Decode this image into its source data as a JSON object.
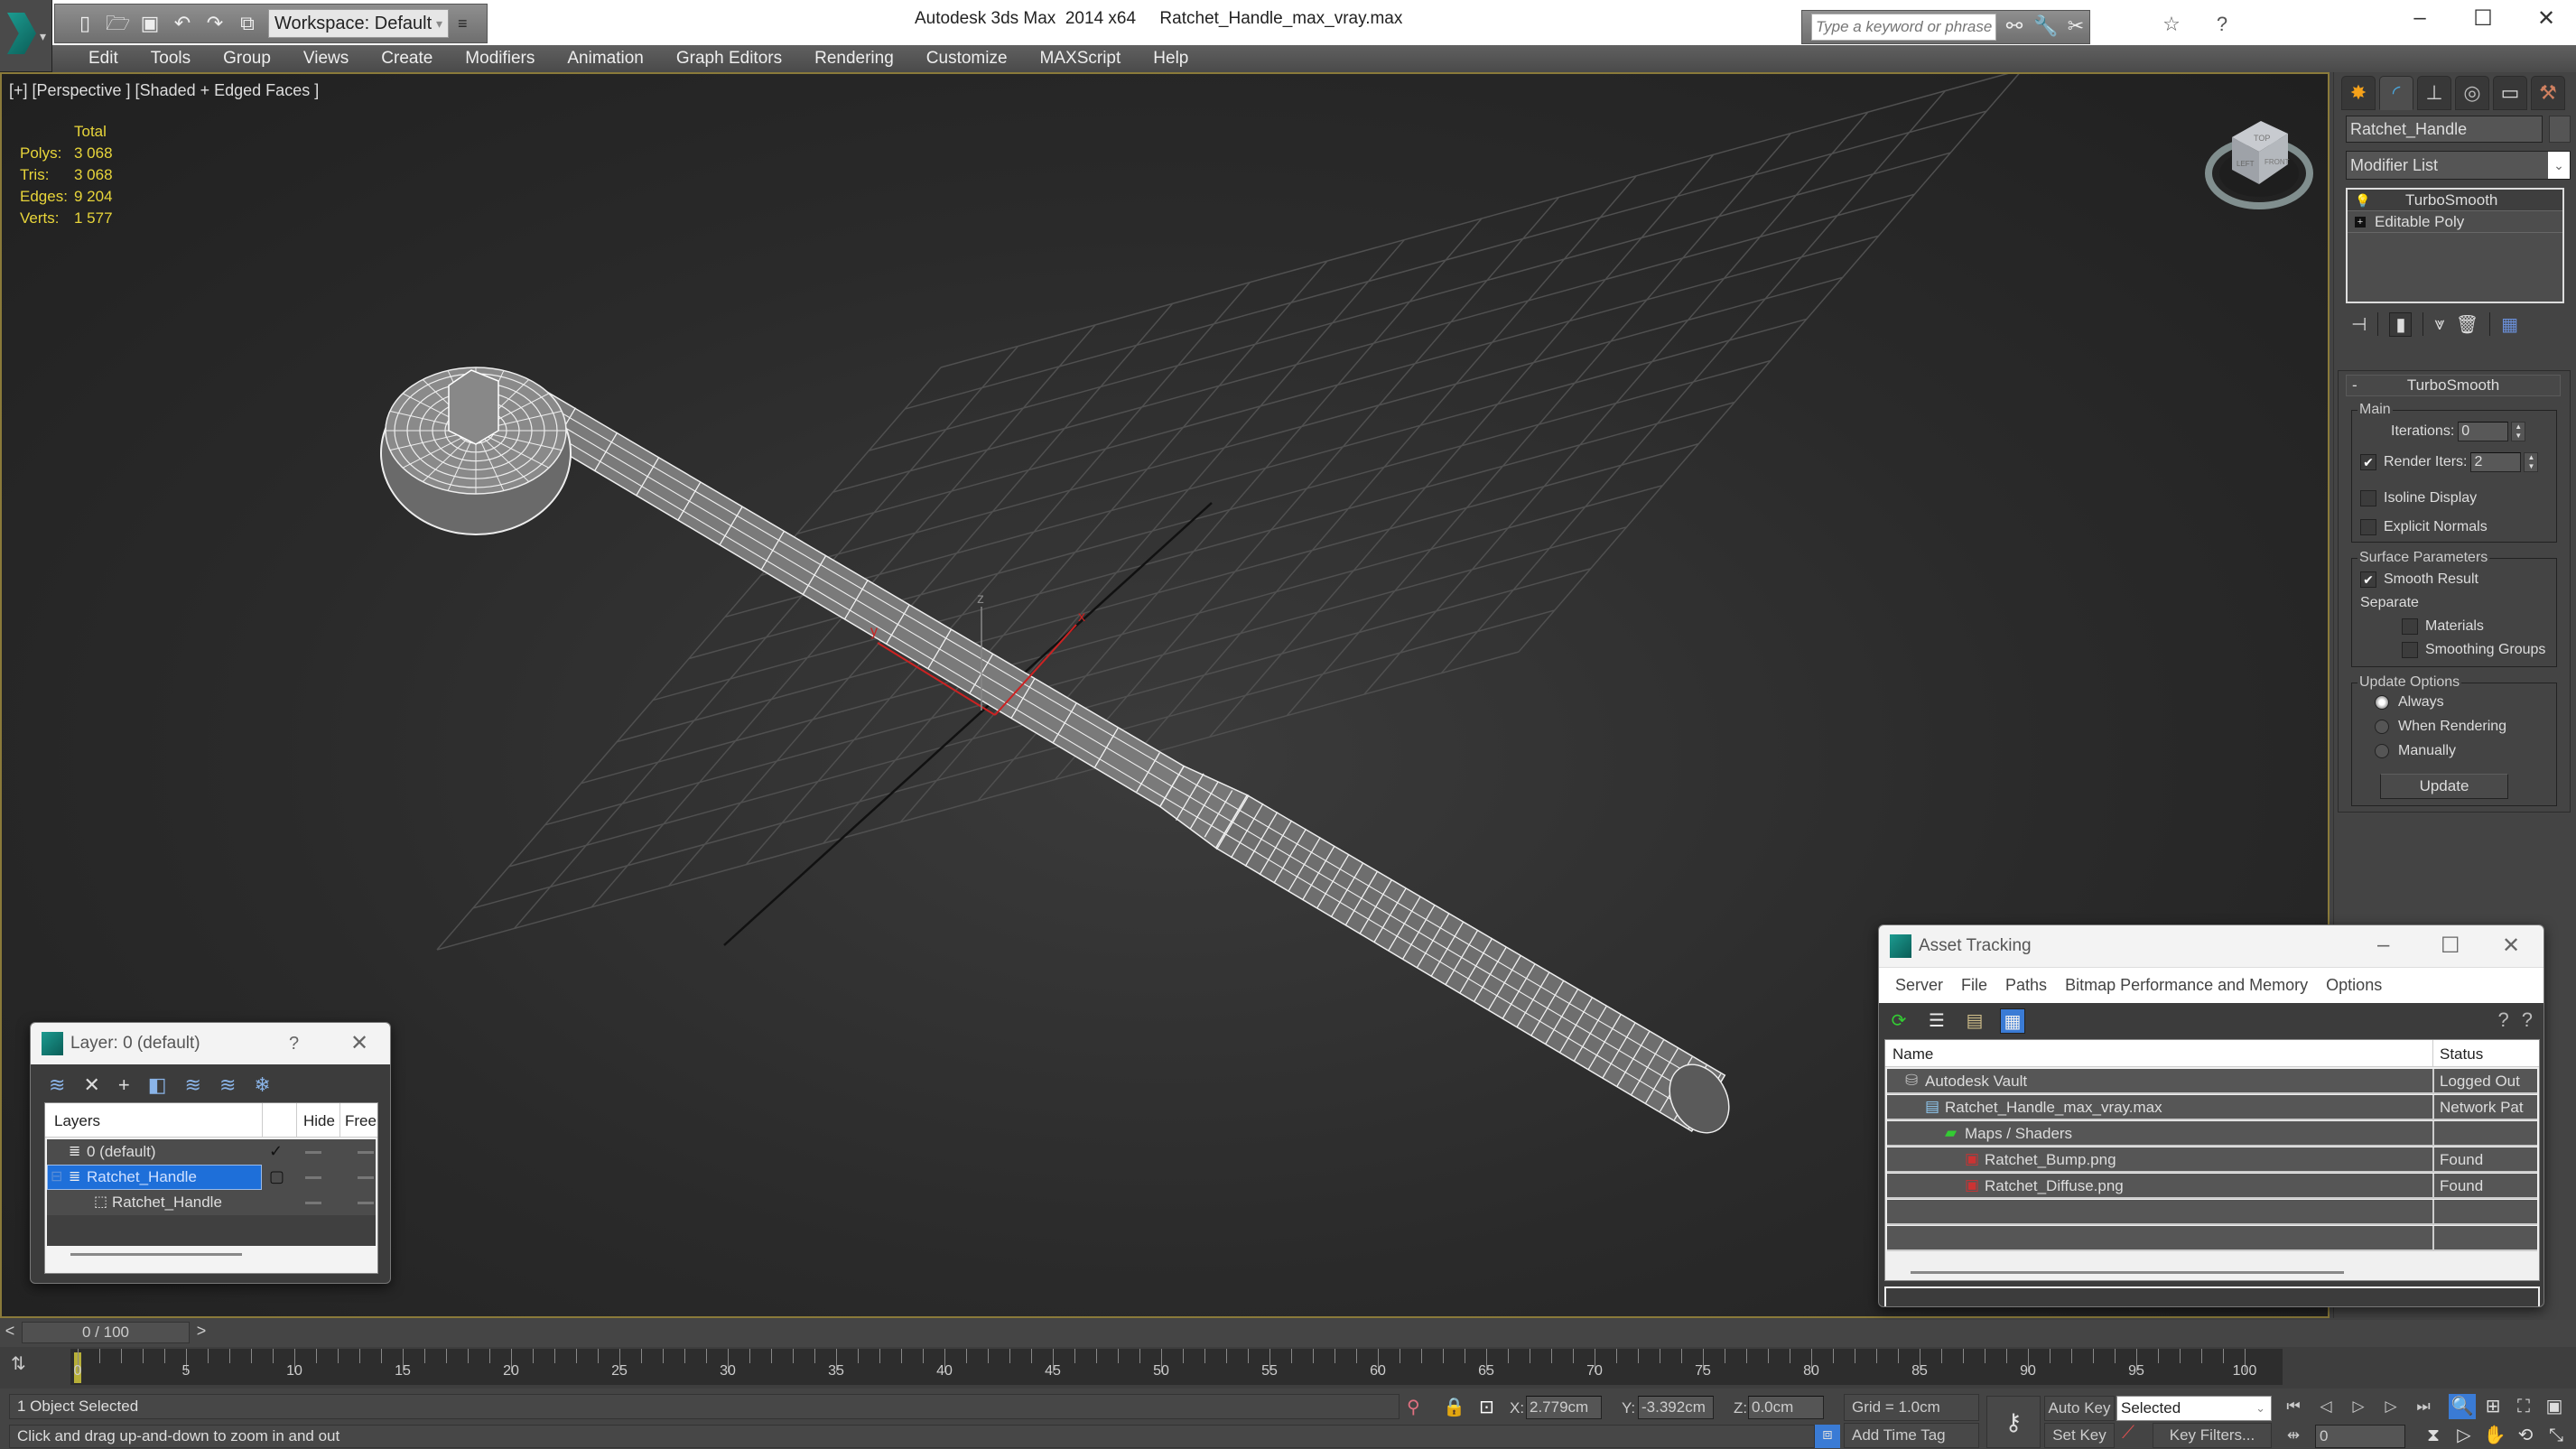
{
  "titlebar": {
    "app_title": "Autodesk 3ds Max  2014 x64     Ratchet_Handle_max_vray.max",
    "workspace": "Workspace: Default",
    "search_placeholder": "Type a keyword or phrase",
    "minimize": "–",
    "maximize": "☐",
    "close": "✕"
  },
  "menu": [
    "Edit",
    "Tools",
    "Group",
    "Views",
    "Create",
    "Modifiers",
    "Animation",
    "Graph Editors",
    "Rendering",
    "Customize",
    "MAXScript",
    "Help"
  ],
  "viewport": {
    "label": "[+] [Perspective ] [Shaded + Edged Faces ]",
    "stats": {
      "header": "Total",
      "rows": [
        {
          "k": "Polys:",
          "v": "3 068"
        },
        {
          "k": "Tris:",
          "v": "3 068"
        },
        {
          "k": "Edges:",
          "v": "9 204"
        },
        {
          "k": "Verts:",
          "v": "1 577"
        }
      ]
    },
    "viewcube_faces": {
      "top": "TOP",
      "left": "LEFT",
      "front": "FRONT"
    },
    "axis_labels": {
      "x": "x",
      "y": "y",
      "z": "z"
    }
  },
  "command_panel": {
    "object_name": "Ratchet_Handle",
    "modifier_list": "Modifier List",
    "stack": [
      {
        "label": "TurboSmooth",
        "icon": "lightbulb-icon"
      },
      {
        "label": "Editable Poly",
        "icon": "expand-plus-icon"
      }
    ],
    "rollout": {
      "title": "TurboSmooth",
      "collapse": "-",
      "main_group": "Main",
      "iterations_label": "Iterations:",
      "iterations": "0",
      "render_iters_label": "Render Iters:",
      "render_iters": "2",
      "render_iters_checked": true,
      "isoline_display": "Isoline Display",
      "isoline_checked": false,
      "explicit_normals": "Explicit Normals",
      "explicit_checked": false,
      "surface_group": "Surface Parameters",
      "smooth_result": "Smooth Result",
      "smooth_checked": true,
      "separate": "Separate",
      "materials": "Materials",
      "materials_checked": false,
      "smoothing_groups": "Smoothing Groups",
      "smoothing_checked": false,
      "update_group": "Update Options",
      "update_options": [
        "Always",
        "When Rendering",
        "Manually"
      ],
      "update_selected": "Always",
      "update_button": "Update"
    }
  },
  "layer_dialog": {
    "title": "Layer: 0 (default)",
    "help": "?",
    "close": "✕",
    "columns": {
      "layers": "Layers",
      "hide": "Hide",
      "freeze": "Free"
    },
    "rows": [
      {
        "name": "0 (default)",
        "current": true,
        "selected": false,
        "level": 0,
        "type": "layer"
      },
      {
        "name": "Ratchet_Handle",
        "current": false,
        "selected": true,
        "level": 0,
        "type": "layer"
      },
      {
        "name": "Ratchet_Handle",
        "current": false,
        "selected": false,
        "level": 1,
        "type": "object"
      }
    ]
  },
  "asset_dialog": {
    "title": "Asset Tracking",
    "menu": [
      "Server",
      "File",
      "Paths",
      "Bitmap Performance and Memory",
      "Options"
    ],
    "columns": {
      "name": "Name",
      "status": "Status"
    },
    "rows": [
      {
        "name": "Autodesk Vault",
        "status": "Logged Out",
        "level": 0,
        "icon": "vault-icon"
      },
      {
        "name": "Ratchet_Handle_max_vray.max",
        "status": "Network Pat",
        "level": 1,
        "icon": "max-file-icon"
      },
      {
        "name": "Maps / Shaders",
        "status": "",
        "level": 2,
        "icon": "maps-icon"
      },
      {
        "name": "Ratchet_Bump.png",
        "status": "Found",
        "level": 3,
        "icon": "png-file-icon"
      },
      {
        "name": "Ratchet_Diffuse.png",
        "status": "Found",
        "level": 3,
        "icon": "png-file-icon"
      }
    ]
  },
  "timeline": {
    "slider_label": "0 / 100",
    "current_frame": 0,
    "start": 0,
    "end": 100,
    "labels": [
      "0",
      "5",
      "10",
      "15",
      "20",
      "25",
      "30",
      "35",
      "40",
      "45",
      "50",
      "55",
      "60",
      "65",
      "70",
      "75",
      "80",
      "85",
      "90",
      "95",
      "100"
    ]
  },
  "status": {
    "selection": "1 Object Selected",
    "prompt": "Click and drag up-and-down to zoom in and out",
    "x_label": "X:",
    "x": "2.779cm",
    "y_label": "Y:",
    "y": "-3.392cm",
    "z_label": "Z:",
    "z": "0.0cm",
    "grid": "Grid = 1.0cm",
    "add_time_tag": "Add Time Tag",
    "auto_key": "Auto Key",
    "set_key": "Set Key",
    "key_mode": "Selected",
    "key_filters": "Key Filters...",
    "frame": "0"
  }
}
